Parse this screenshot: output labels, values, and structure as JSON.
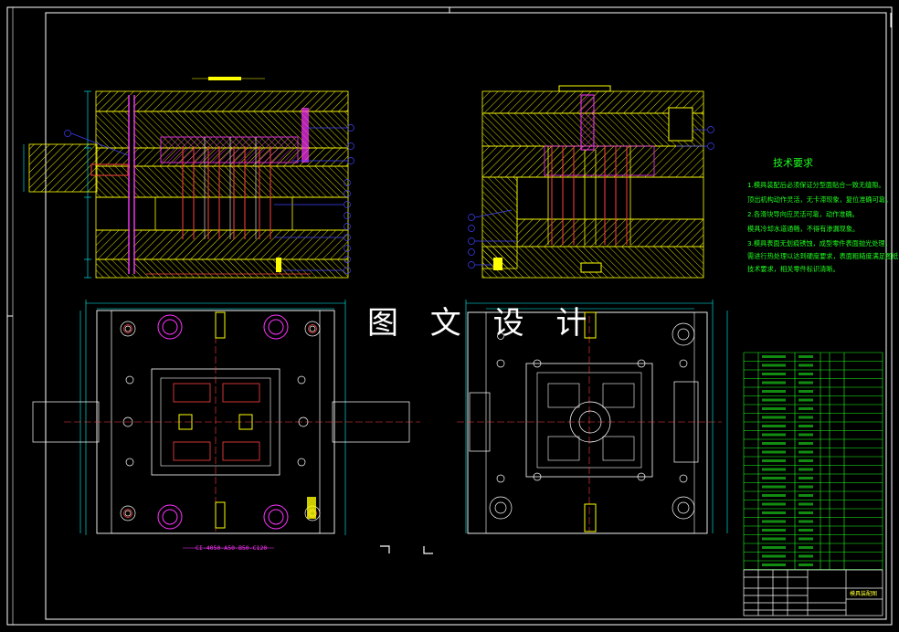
{
  "watermark": "图 文 设 计",
  "tech_requirements": {
    "title": "技术要求",
    "lines": [
      "1.模具装配后必须保证分型面贴合一致无缝隙。",
      "顶出机构动作灵活，无卡滞现象，复位准确可靠。",
      "2.各滑块导向应灵活可靠，动作准确。",
      "模具冷却水道通畅，不得有渗漏现象。",
      "3.模具表面无划痕锈蚀，成型零件表面抛光处理，",
      "需进行热处理以达到硬度要求，表面粗糙度满足图纸",
      "技术要求，相关零件标识清晰。"
    ]
  },
  "labels": {
    "mold_base_spec": "CI-4050-A50-B50-C120",
    "title_block_name": "模具装配图"
  },
  "colors": {
    "background": "#000000",
    "frame": "#ffffff",
    "plate_fill": "#ffff00",
    "cavity": "#ff33ff",
    "dimension": "#00ffff",
    "balloon": "#4040ff",
    "part_line": "#ff4040",
    "table": "#1fff1f",
    "hatch": "#ffff00"
  }
}
